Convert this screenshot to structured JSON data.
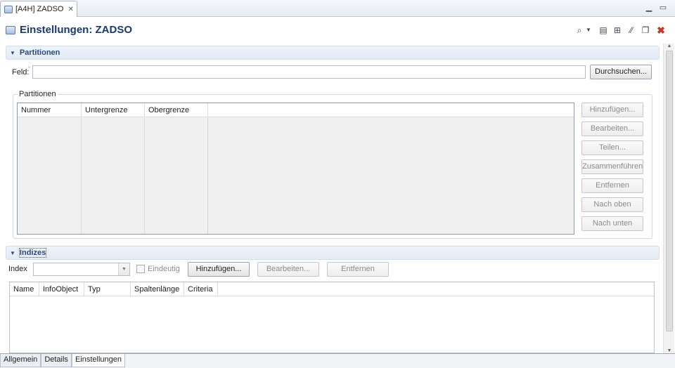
{
  "tab": {
    "title": "[A4H] ZADSO"
  },
  "header": {
    "title": "Einstellungen: ZADSO"
  },
  "partitionen_section": {
    "title": "Partitionen",
    "feld_label": "Feld:",
    "feld_value": "",
    "durchsuchen_label": "Durchsuchen...",
    "group_title": "Partitionen",
    "columns": [
      "Nummer",
      "Untergrenze",
      "Obergrenze"
    ],
    "buttons": [
      "Hinzufügen...",
      "Bearbeiten...",
      "Teilen...",
      "Zusammenführen",
      "Entfernen",
      "Nach oben",
      "Nach unten"
    ]
  },
  "indizes_section": {
    "title": "Indizes",
    "index_label": "Index",
    "index_value": "",
    "eindeutig_label": "Eindeutig",
    "add_label": "Hinzufügen...",
    "edit_label": "Bearbeiten...",
    "remove_label": "Entfernen",
    "columns": [
      "Name",
      "InfoObject",
      "Typ",
      "Spaltenlänge",
      "Criteria"
    ]
  },
  "bottom_tabs": [
    "Allgemein",
    "Details",
    "Einstellungen"
  ],
  "colors": {
    "title_blue": "#1a3a6b",
    "section_blue": "#2b4a78",
    "delete_red": "#c0392b"
  }
}
